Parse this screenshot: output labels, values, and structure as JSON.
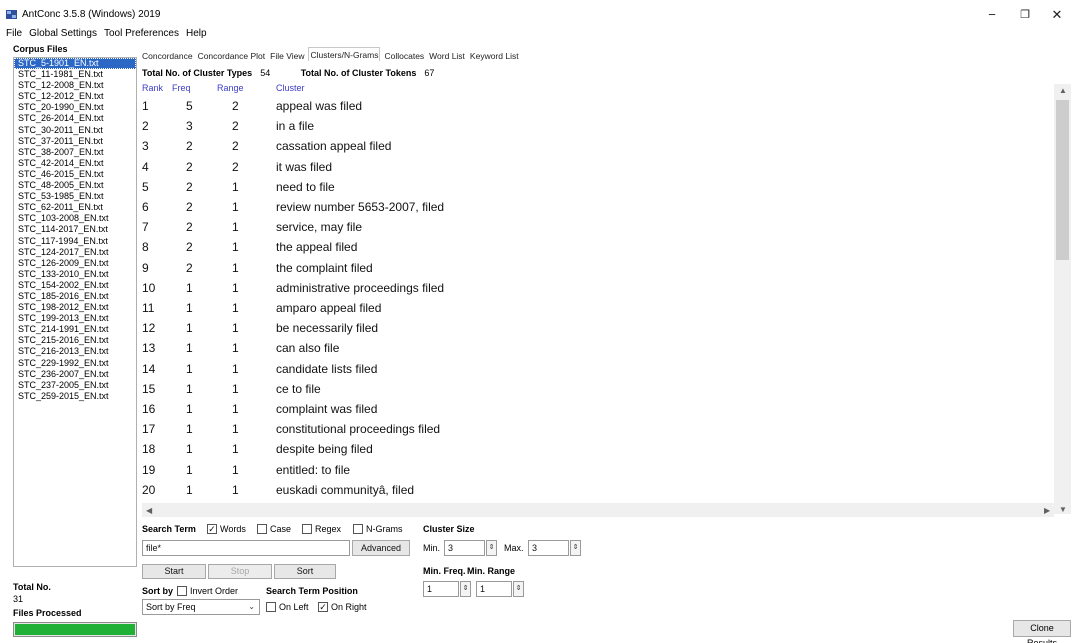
{
  "window": {
    "title": "AntConc 3.5.8 (Windows) 2019",
    "minimize": "−",
    "maximize": "❐",
    "close": "✕"
  },
  "menu": [
    "File",
    "Global Settings",
    "Tool Preferences",
    "Help"
  ],
  "corpus": {
    "label": "Corpus Files",
    "files": [
      "STC_5-1901_EN.txt",
      "STC_11-1981_EN.txt",
      "STC_12-2008_EN.txt",
      "STC_12-2012_EN.txt",
      "STC_20-1990_EN.txt",
      "STC_26-2014_EN.txt",
      "STC_30-2011_EN.txt",
      "STC_37-2011_EN.txt",
      "STC_38-2007_EN.txt",
      "STC_42-2014_EN.txt",
      "STC_46-2015_EN.txt",
      "STC_48-2005_EN.txt",
      "STC_53-1985_EN.txt",
      "STC_62-2011_EN.txt",
      "STC_103-2008_EN.txt",
      "STC_114-2017_EN.txt",
      "STC_117-1994_EN.txt",
      "STC_124-2017_EN.txt",
      "STC_126-2009_EN.txt",
      "STC_133-2010_EN.txt",
      "STC_154-2002_EN.txt",
      "STC_185-2016_EN.txt",
      "STC_198-2012_EN.txt",
      "STC_199-2013_EN.txt",
      "STC_214-1991_EN.txt",
      "STC_215-2016_EN.txt",
      "STC_216-2013_EN.txt",
      "STC_229-1992_EN.txt",
      "STC_236-2007_EN.txt",
      "STC_237-2005_EN.txt",
      "STC_259-2015_EN.txt"
    ],
    "selected_index": 0,
    "total_label": "Total No.",
    "total_value": "31",
    "processed_label": "Files Processed",
    "progress": 1.0,
    "progress_color": "#20b038"
  },
  "tabs": [
    {
      "label": "Concordance",
      "active": false
    },
    {
      "label": "Concordance Plot",
      "active": false
    },
    {
      "label": "File View",
      "active": false
    },
    {
      "label": "Clusters/N-Grams",
      "active": true
    },
    {
      "label": "Collocates",
      "active": false
    },
    {
      "label": "Word List",
      "active": false
    },
    {
      "label": "Keyword List",
      "active": false
    }
  ],
  "stats": {
    "types_label": "Total No. of Cluster Types",
    "types_value": "54",
    "tokens_label": "Total No. of Cluster Tokens",
    "tokens_value": "67"
  },
  "columns": {
    "rank": "Rank",
    "freq": "Freq",
    "range": "Range",
    "cluster": "Cluster"
  },
  "rows": [
    {
      "rank": "1",
      "freq": "5",
      "range": "2",
      "cluster": "appeal was filed"
    },
    {
      "rank": "2",
      "freq": "3",
      "range": "2",
      "cluster": "in a file"
    },
    {
      "rank": "3",
      "freq": "2",
      "range": "2",
      "cluster": "cassation appeal filed"
    },
    {
      "rank": "4",
      "freq": "2",
      "range": "2",
      "cluster": "it was filed"
    },
    {
      "rank": "5",
      "freq": "2",
      "range": "1",
      "cluster": "need to file"
    },
    {
      "rank": "6",
      "freq": "2",
      "range": "1",
      "cluster": "review number 5653-2007, filed"
    },
    {
      "rank": "7",
      "freq": "2",
      "range": "1",
      "cluster": "service, may file"
    },
    {
      "rank": "8",
      "freq": "2",
      "range": "1",
      "cluster": "the appeal filed"
    },
    {
      "rank": "9",
      "freq": "2",
      "range": "1",
      "cluster": "the complaint filed"
    },
    {
      "rank": "10",
      "freq": "1",
      "range": "1",
      "cluster": "administrative proceedings filed"
    },
    {
      "rank": "11",
      "freq": "1",
      "range": "1",
      "cluster": "amparo appeal filed"
    },
    {
      "rank": "12",
      "freq": "1",
      "range": "1",
      "cluster": "be necessarily filed"
    },
    {
      "rank": "13",
      "freq": "1",
      "range": "1",
      "cluster": "can also file"
    },
    {
      "rank": "14",
      "freq": "1",
      "range": "1",
      "cluster": "candidate lists filed"
    },
    {
      "rank": "15",
      "freq": "1",
      "range": "1",
      "cluster": "ce to file"
    },
    {
      "rank": "16",
      "freq": "1",
      "range": "1",
      "cluster": "complaint was filed"
    },
    {
      "rank": "17",
      "freq": "1",
      "range": "1",
      "cluster": "constitutional proceedings filed"
    },
    {
      "rank": "18",
      "freq": "1",
      "range": "1",
      "cluster": "despite being filed"
    },
    {
      "rank": "19",
      "freq": "1",
      "range": "1",
      "cluster": "entitled: to file"
    },
    {
      "rank": "20",
      "freq": "1",
      "range": "1",
      "cluster": "euskadi communityâ, filed"
    }
  ],
  "search": {
    "label": "Search Term",
    "words_label": "Words",
    "words_checked": true,
    "case_label": "Case",
    "case_checked": false,
    "regex_label": "Regex",
    "regex_checked": false,
    "ngrams_label": "N-Grams",
    "ngrams_checked": false,
    "value": "file*",
    "advanced_label": "Advanced",
    "start_label": "Start",
    "stop_label": "Stop",
    "sort_label": "Sort"
  },
  "cluster_size": {
    "label": "Cluster Size",
    "min_label": "Min.",
    "min_value": "3",
    "max_label": "Max.",
    "max_value": "3"
  },
  "min_freq": {
    "label": "Min. Freq.",
    "value": "1"
  },
  "min_range": {
    "label": "Min. Range",
    "value": "1"
  },
  "sort": {
    "label": "Sort by",
    "invert_label": "Invert Order",
    "invert_checked": false,
    "value": "Sort by Freq"
  },
  "position": {
    "label": "Search Term Position",
    "left_label": "On Left",
    "left_checked": false,
    "right_label": "On Right",
    "right_checked": true
  },
  "clone_label": "Clone Results"
}
